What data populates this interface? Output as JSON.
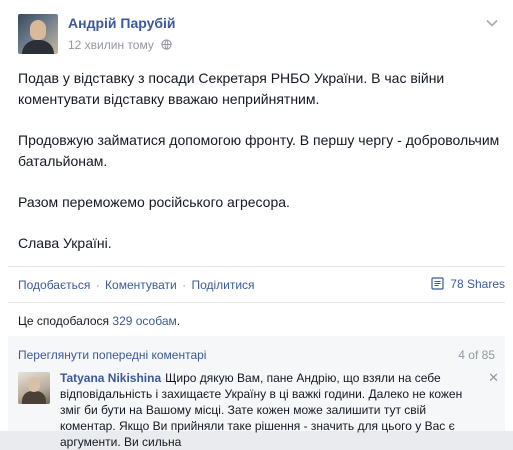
{
  "post": {
    "author": "Андрій Парубій",
    "time": "12 хвилин тому",
    "paragraphs": [
      "Подав у відставку з посади Секретаря РНБО України. В час війни коментувати відставку вважаю неприйнятним.",
      "Продовжую займатися допомогою фронту. В першу чергу - добровольчим батальйонам.",
      "Разом переможемо російського агресора.",
      "Слава Україні."
    ]
  },
  "actions": {
    "like": "Подобається",
    "comment": "Коментувати",
    "share": "Поділитися",
    "sep": "·",
    "shares_count": "78 Shares"
  },
  "likes": {
    "prefix": "Це сподобалося ",
    "link": "329 особам",
    "suffix": "."
  },
  "comments": {
    "view_previous": "Переглянути попередні коментарі",
    "count": "4 of 85",
    "items": [
      {
        "author": "Tatyana Nikishina",
        "text": "Щиро дякую Вам, пане Андрію, що взяли на себе відповідальність і захищаєте Україну в ці важкі години. Далеко не кожен зміг би бути на Вашому місці. Зате кожен може залишити тут свій коментар. Якщо Ви прийняли таке рішення - значить для цього у Вас є аргументи. Ви сильна"
      }
    ]
  },
  "icons": {
    "globe": "globe-icon",
    "chevron": "chevron-down-icon",
    "share": "share-icon",
    "close": "close-icon"
  },
  "colors": {
    "link": "#3b5998",
    "muted": "#9197a3",
    "text": "#141823"
  }
}
